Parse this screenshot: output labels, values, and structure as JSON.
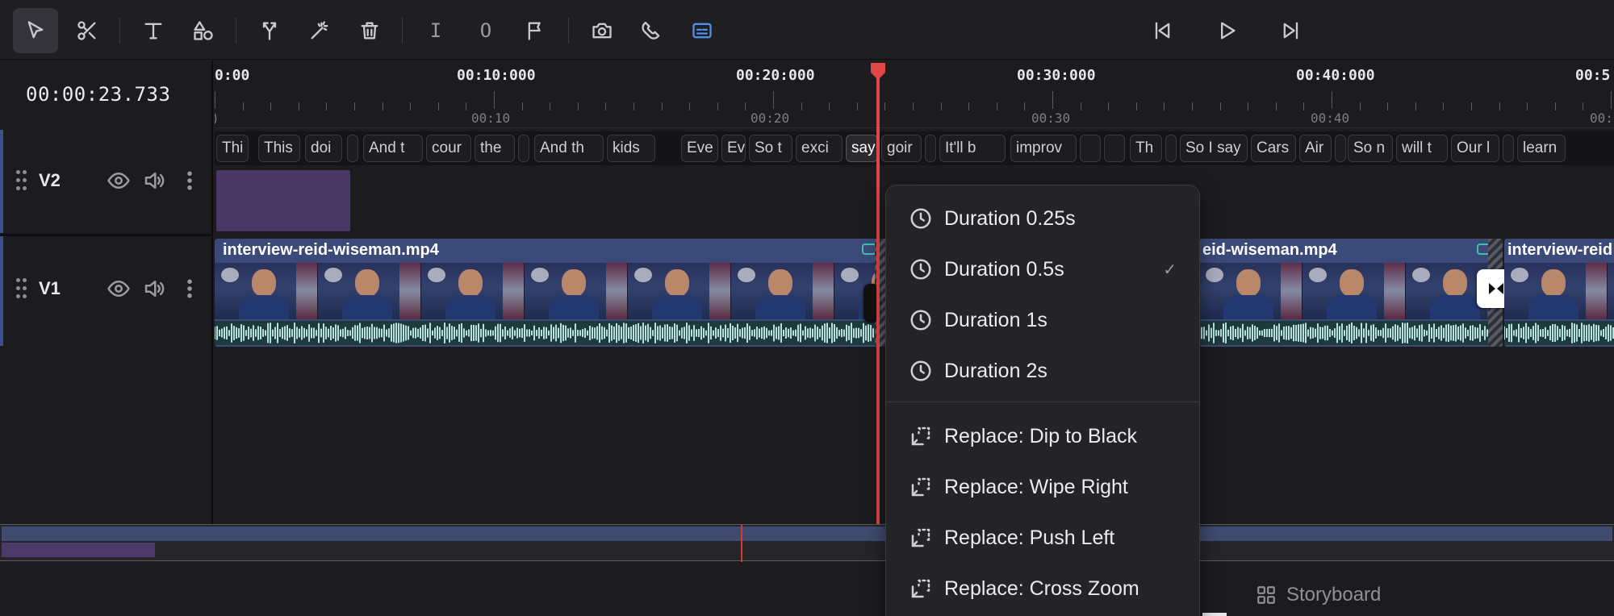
{
  "toolbar": {
    "tools": [
      {
        "name": "select",
        "icon": "pointer-icon",
        "active": true
      },
      {
        "name": "cut",
        "icon": "scissors-icon"
      },
      {
        "name": "text",
        "icon": "text-icon"
      },
      {
        "name": "shapes",
        "icon": "shapes-icon"
      },
      {
        "name": "split",
        "icon": "split-icon"
      },
      {
        "name": "magic",
        "icon": "magic-wand-icon"
      },
      {
        "name": "delete",
        "icon": "trash-icon"
      },
      {
        "name": "in-point",
        "icon": "mark-in-icon",
        "glyph": "I"
      },
      {
        "name": "out-point",
        "icon": "mark-out-icon",
        "glyph": "O"
      },
      {
        "name": "marker",
        "icon": "flag-icon"
      },
      {
        "name": "snapshot",
        "icon": "camera-icon"
      },
      {
        "name": "snap",
        "icon": "magnet-icon"
      },
      {
        "name": "captions",
        "icon": "captions-icon",
        "accent": "#4f8fe8"
      }
    ],
    "playback": [
      "skip-back-icon",
      "play-icon",
      "skip-forward-icon"
    ]
  },
  "timecode": "00:00:23.733",
  "ruler": {
    "major_labels": [
      "0:00",
      "00:10:000",
      "00:20:000",
      "00:30:000",
      "00:40:000",
      "00:5"
    ],
    "minor_labels": [
      ")",
      "00:10",
      "00:20",
      "00:30",
      "00:40",
      "00:5"
    ]
  },
  "tracks": [
    {
      "name": "V2"
    },
    {
      "name": "V1"
    }
  ],
  "captions": [
    "Thi",
    "This",
    "doi",
    "",
    "And t",
    "cour",
    "the",
    "",
    "And th",
    "kids",
    "Eve",
    "Ev",
    "So t",
    "exci",
    "say",
    "goir",
    "",
    "It'll b",
    "improv",
    "",
    "",
    "Th",
    "",
    "So I say",
    "Cars",
    "Air",
    "",
    "So n",
    "will t",
    "Our l",
    "",
    "learn"
  ],
  "clips": {
    "left_title": "interview-reid-wiseman.mp4",
    "middle_title": "eid-wiseman.mp4",
    "right_title": "interview-reid"
  },
  "menu": {
    "items": [
      {
        "label": "Duration 0.25s",
        "icon": "clock-icon",
        "checked": false
      },
      {
        "label": "Duration 0.5s",
        "icon": "clock-icon",
        "checked": true
      },
      {
        "label": "Duration 1s",
        "icon": "clock-icon",
        "checked": false
      },
      {
        "label": "Duration 2s",
        "icon": "clock-icon",
        "checked": false
      },
      {
        "label": "Replace: Dip to Black",
        "icon": "replace-icon",
        "checked": false
      },
      {
        "label": "Replace: Wipe Right",
        "icon": "replace-icon",
        "checked": false
      },
      {
        "label": "Replace: Push Left",
        "icon": "replace-icon",
        "checked": false
      },
      {
        "label": "Replace: Cross Zoom",
        "icon": "replace-icon",
        "checked": false
      }
    ],
    "check_glyph": "✓"
  },
  "bottom": {
    "storyboard_label": "Storyboard"
  },
  "colors": {
    "playhead": "#e04646",
    "track_accent": "#3f4d8c",
    "v2_clip": "#4a3766",
    "video_clip": "#3c4a7a",
    "waveform": "#b8e0dc"
  }
}
